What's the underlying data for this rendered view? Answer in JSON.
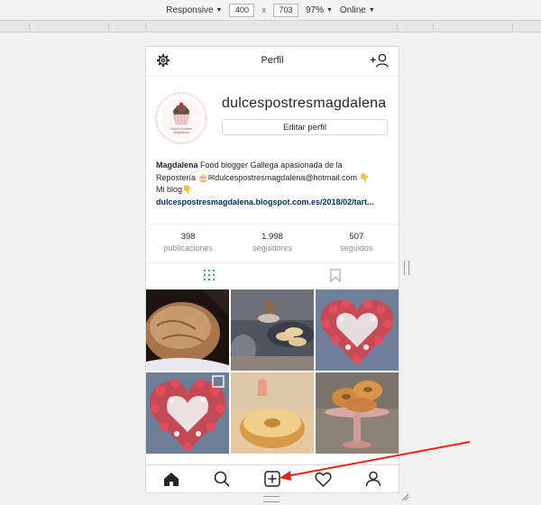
{
  "devtools": {
    "device": "Responsive",
    "width": "400",
    "separator": "x",
    "height": "703",
    "zoom": "97%",
    "network": "Online"
  },
  "header": {
    "title": "Perfil",
    "settings_icon": "gear-icon",
    "add_user_icon": "add-user-icon"
  },
  "profile": {
    "username": "dulcespostresmagdalena",
    "edit_label": "Editar perfil",
    "avatar_caption_1": "Dulces Postres",
    "avatar_caption_2": "Magdalena"
  },
  "bio": {
    "name": "Magdalena",
    "line1": " Food blogger Gallega apasionada de la",
    "line2": "Repostería 🎂✉dulcespostresmagdalena@hotmail.com 👇",
    "line3": "Mi blog👇",
    "link": "dulcespostresmagdalena.blogspot.com.es/2018/02/tart..."
  },
  "stats": [
    {
      "number": "398",
      "label": "publicaciones"
    },
    {
      "number": "1.998",
      "label": "seguidores"
    },
    {
      "number": "507",
      "label": "seguidos"
    }
  ],
  "view_tabs": {
    "grid_icon": "grid-icon",
    "saved_icon": "bookmark-icon"
  },
  "grid_posts": [
    {
      "name": "post-bread",
      "multi": false
    },
    {
      "name": "post-cookies",
      "multi": false
    },
    {
      "name": "post-heart-cake",
      "multi": false
    },
    {
      "name": "post-heart-cake-2",
      "multi": true
    },
    {
      "name": "post-donut",
      "multi": false
    },
    {
      "name": "post-donut-stand",
      "multi": false
    }
  ],
  "bottom_nav": [
    "home-icon",
    "search-icon",
    "new-post-icon",
    "heart-icon",
    "profile-icon"
  ],
  "colors": {
    "link": "#003569",
    "muted": "#8e8e8e",
    "border": "#dbdbdb",
    "arrow": "#e0261e",
    "tab_active": "#3897f0"
  }
}
